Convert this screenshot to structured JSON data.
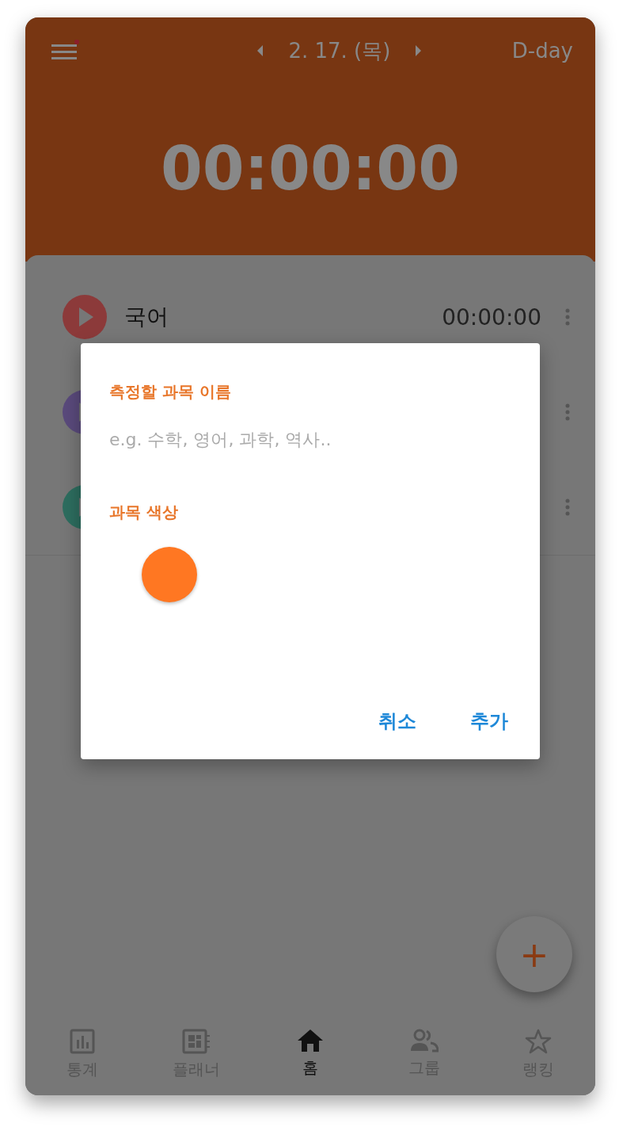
{
  "header": {
    "menu_badge": true,
    "date": "2. 17. (목)",
    "dday": "D-day",
    "timer": "00:00:00"
  },
  "subjects": [
    {
      "name": "국어",
      "time": "00:00:00",
      "color": "#8c3a3a"
    },
    {
      "color": "#5a4a7c"
    },
    {
      "color": "#2d6d5f"
    }
  ],
  "dialog": {
    "name_label": "측정할 과목 이름",
    "placeholder": "e.g. 수학, 영어, 과학, 역사..",
    "color_label": "과목 색상",
    "color": "#ff7722",
    "buttons": [
      "취소",
      "추가"
    ]
  },
  "fab": "+",
  "nav": [
    {
      "label": "통계",
      "kind": "chart",
      "selected": false
    },
    {
      "label": "플래너",
      "kind": "planner",
      "selected": false
    },
    {
      "label": "홈",
      "kind": "home",
      "selected": true
    },
    {
      "label": "그룹",
      "kind": "group",
      "selected": false
    },
    {
      "label": "랭킹",
      "kind": "star",
      "selected": false
    }
  ]
}
